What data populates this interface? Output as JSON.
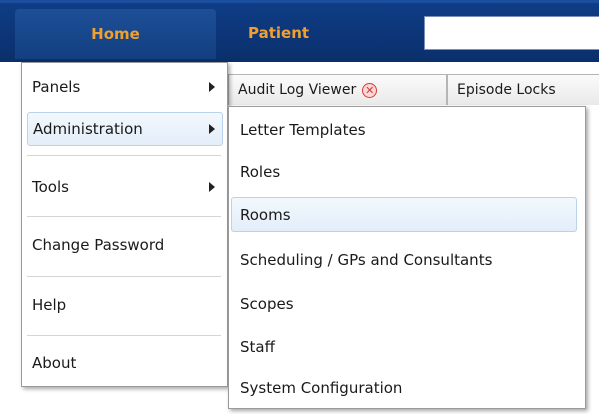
{
  "nav": {
    "home_label": "Home",
    "patient_label": "Patient",
    "search_value": ""
  },
  "tabs": [
    {
      "label": "Audit Log Viewer",
      "closable": true
    },
    {
      "label": "Episode Locks",
      "closable": false
    }
  ],
  "menu": {
    "items": [
      {
        "label": "Panels",
        "has_submenu": true
      },
      {
        "label": "Administration",
        "has_submenu": true,
        "highlighted": true
      },
      {
        "label": "Tools",
        "has_submenu": true
      },
      {
        "label": "Change Password",
        "has_submenu": false
      },
      {
        "label": "Help",
        "has_submenu": false
      },
      {
        "label": "About",
        "has_submenu": false
      }
    ]
  },
  "submenu": {
    "items": [
      {
        "label": "Letter Templates"
      },
      {
        "label": "Roles"
      },
      {
        "label": "Rooms",
        "highlighted": true
      },
      {
        "label": "Scheduling / GPs and Consultants"
      },
      {
        "label": "Scopes"
      },
      {
        "label": "Staff"
      },
      {
        "label": "System Configuration"
      }
    ]
  },
  "colors": {
    "nav_bg": "#0a2f6b",
    "nav_text": "#f0a030",
    "highlight_bg": "#e3eef9",
    "highlight_border": "#b9d3ec",
    "close_icon": "#d23a3a"
  }
}
